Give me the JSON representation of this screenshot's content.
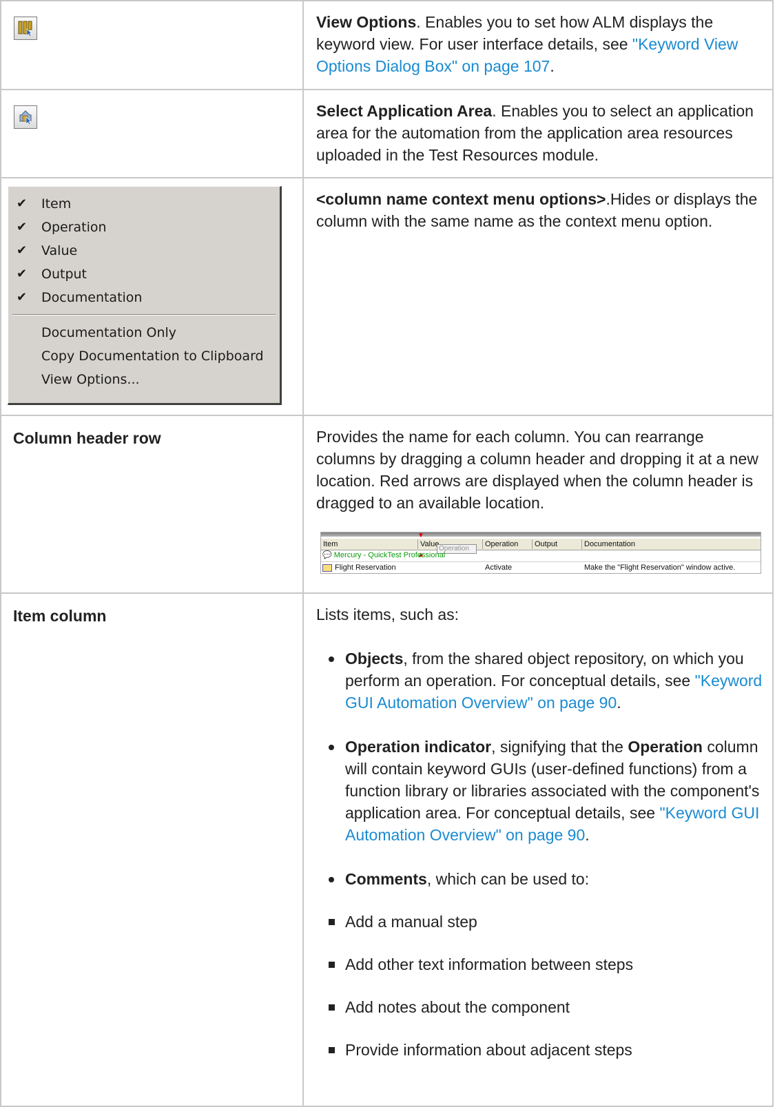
{
  "rows": {
    "view_options": {
      "title": "View Options",
      "desc": ". Enables you to set how ALM displays the keyword view. For user interface details, see ",
      "link": "\"Keyword View Options Dialog Box\" on page 107",
      "tail": "."
    },
    "select_app_area": {
      "title": "Select Application Area",
      "desc": ". Enables you to select an application area for the automation from the application area resources uploaded in the Test Resources module."
    },
    "context_menu_row": {
      "title": "<column name context menu options>",
      "desc": ".Hides or displays the column with the same name as the context menu option.",
      "menu": {
        "checked_items": [
          "Item",
          "Operation",
          "Value",
          "Output",
          "Documentation"
        ],
        "plain_items": [
          "Documentation Only",
          "Copy Documentation to Clipboard",
          "View Options..."
        ],
        "check_glyph": "✔"
      }
    },
    "column_header_row": {
      "label": "Column header row",
      "desc": "Provides the name for each column. You can rearrange columns by dragging a column header and dropping it at a new location. Red arrows are displayed when the column header is dragged to an available location.",
      "mini": {
        "columns": [
          "Item",
          "Value",
          "Operation",
          "Output",
          "Documentation"
        ],
        "dragging": "Operation",
        "row1": "Mercury - QuickTest Professional",
        "row2_item": "Flight Reservation",
        "row2_op": "Activate",
        "row2_doc": "Make the \"Flight Reservation\" window active."
      }
    },
    "item_column": {
      "label": "Item column",
      "intro": "Lists items, such as:",
      "objects": {
        "bold": "Objects",
        "text": ", from the shared object repository, on which you perform an operation. For conceptual details, see ",
        "link": "\"Keyword GUI Automation Overview\" on page 90",
        "tail": "."
      },
      "operation_indicator": {
        "bold": "Operation indicator",
        "text1": ", signifying that the ",
        "bold2": "Operation",
        "text2": " column will contain keyword GUIs (user-defined functions) from a function library or libraries associated with the component's application area. For conceptual details, see ",
        "link": "\"Keyword GUI Automation Overview\" on page 90",
        "tail": "."
      },
      "comments": {
        "bold": "Comments",
        "text": ", which can be used to:"
      },
      "sub_items": [
        "Add a manual step",
        "Add other text information between steps",
        "Add notes about the component",
        "Provide information about adjacent steps"
      ]
    }
  },
  "colors": {
    "link": "#1a8bd1",
    "border": "#c8c8c8",
    "menu_bg": "#d6d3ce"
  }
}
